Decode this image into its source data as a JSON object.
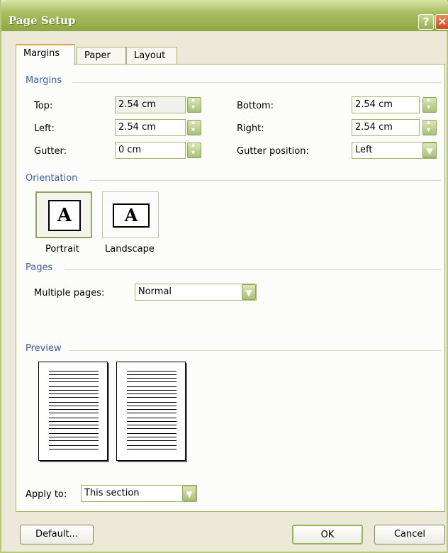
{
  "window": {
    "title": "Page Setup"
  },
  "tabs": [
    {
      "label": "Margins"
    },
    {
      "label": "Paper"
    },
    {
      "label": "Layout"
    }
  ],
  "margins": {
    "section_title": "Margins",
    "top_label": "Top:",
    "top_value": "2.54 cm",
    "bottom_label": "Bottom:",
    "bottom_value": "2.54 cm",
    "left_label": "Left:",
    "left_value": "2.54 cm",
    "right_label": "Right:",
    "right_value": "2.54 cm",
    "gutter_label": "Gutter:",
    "gutter_value": "0 cm",
    "gutter_position_label": "Gutter position:",
    "gutter_position_value": "Left"
  },
  "orientation": {
    "section_title": "Orientation",
    "portrait_label": "Portrait",
    "landscape_label": "Landscape",
    "icon_glyph": "A",
    "selected": "portrait"
  },
  "pages": {
    "section_title": "Pages",
    "multiple_pages_label": "Multiple pages:",
    "multiple_pages_value": "Normal"
  },
  "preview": {
    "section_title": "Preview"
  },
  "apply_to": {
    "label": "Apply to:",
    "value": "This section"
  },
  "buttons": {
    "default": "Default...",
    "ok": "OK",
    "cancel": "Cancel"
  },
  "colors": {
    "title_bar": "#a9bd61",
    "section_title": "#3a5ea8",
    "dialog_bg": "#ece9d8"
  }
}
